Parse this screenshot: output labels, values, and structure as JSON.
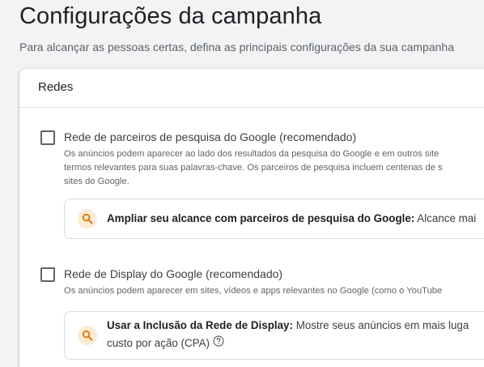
{
  "page": {
    "title": "Configurações da campanha",
    "subtitle": "Para alcançar as pessoas certas, defina as principais configurações da sua campanha"
  },
  "networks": {
    "title": "Redes",
    "search_partners": {
      "label": "Rede de parceiros de pesquisa do Google (recomendado)",
      "checked": false,
      "description_lines": [
        "Os anúncios podem aparecer ao lado dos resultados da pesquisa do Google e em outros site",
        "termos relevantes para suas palavras-chave. Os parceiros de pesquisa incluem centenas de s",
        "sites do Google."
      ],
      "suggestion": {
        "icon": "search-icon",
        "title": "Ampliar seu alcance com parceiros de pesquisa do Google:",
        "text": "Alcance mai"
      }
    },
    "display_network": {
      "label": "Rede de Display do Google (recomendado)",
      "checked": false,
      "description_lines": [
        "Os anúncios podem aparecer em sites, vídeos e apps relevantes no Google (como o YouTube"
      ],
      "suggestion": {
        "icon": "search-icon",
        "title": "Usar a Inclusão da Rede de Display:",
        "text": "Mostre seus anúncios em mais luga",
        "text_line2": "custo por ação (CPA)",
        "help_icon": "help-circle-icon"
      }
    }
  },
  "colors": {
    "background": "#f1f3f4",
    "card": "#ffffff",
    "icon_bg": "#fdebd6",
    "icon_fg": "#e37400"
  }
}
